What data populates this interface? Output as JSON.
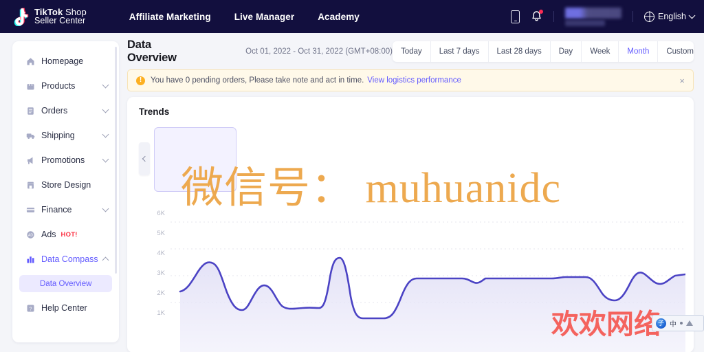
{
  "topnav": {
    "brand": {
      "line1_bold": "TikTok",
      "line1_thin": " Shop",
      "line2": "Seller Center"
    },
    "links": [
      {
        "label": "Affiliate Marketing"
      },
      {
        "label": "Live Manager"
      },
      {
        "label": "Academy"
      }
    ],
    "icons": {
      "mobile": "mobile-icon",
      "bell": "bell-icon"
    },
    "language": {
      "label": "English",
      "icon": "globe-icon"
    },
    "background": "#120f3e"
  },
  "sidebar": {
    "items": [
      {
        "label": "Homepage",
        "icon": "home-icon",
        "caret": false,
        "active": false
      },
      {
        "label": "Products",
        "icon": "bag-icon",
        "caret": "down",
        "active": false
      },
      {
        "label": "Orders",
        "icon": "list-icon",
        "caret": "down",
        "active": false
      },
      {
        "label": "Shipping",
        "icon": "truck-icon",
        "caret": "down",
        "active": false
      },
      {
        "label": "Promotions",
        "icon": "megaphone-icon",
        "caret": "down",
        "active": false
      },
      {
        "label": "Store Design",
        "icon": "store-icon",
        "caret": false,
        "active": false
      },
      {
        "label": "Finance",
        "icon": "card-icon",
        "caret": "down",
        "active": false
      },
      {
        "label": "Ads",
        "icon": "ads-icon",
        "caret": false,
        "active": false,
        "badge": "HOT!"
      },
      {
        "label": "Data Compass",
        "icon": "bar-chart-icon",
        "caret": "up",
        "active": true
      }
    ],
    "subitem": {
      "label": "Data Overview",
      "selected": true
    },
    "last_item": {
      "label": "Help Center",
      "icon": "help-icon"
    },
    "accent": "#635bff"
  },
  "main": {
    "page_title": "Data Overview",
    "date_range": "Oct 01, 2022 - Oct 31, 2022 (GMT+08:00)",
    "range_tabs": [
      {
        "label": "Today",
        "active": false
      },
      {
        "label": "Last 7 days",
        "active": false
      },
      {
        "label": "Last 28 days",
        "active": false
      },
      {
        "label": "Day",
        "active": false
      },
      {
        "label": "Week",
        "active": false
      },
      {
        "label": "Month",
        "active": true
      },
      {
        "label": "Custom",
        "active": false
      }
    ],
    "alert": {
      "icon": "warning-icon",
      "text": "You have 0 pending orders, Please take note and act in time.",
      "link": "View logistics performance",
      "close": "×",
      "bg": "#fff9e9",
      "border": "#f7e3b6"
    },
    "panel": {
      "title": "Trends",
      "scroll_left_icon": "chevron-left-icon"
    }
  },
  "chart_data": {
    "type": "area",
    "title": "Trends",
    "xlabel": "",
    "ylabel": "",
    "ylim": [
      0,
      6500
    ],
    "grid": true,
    "legend": null,
    "line_color": "#4b43c4",
    "fill_color": "#e7e6f7",
    "ytick_labels": [
      "1K",
      "2K",
      "3K",
      "4K",
      "5K",
      "6K"
    ],
    "ytick_values": [
      1000,
      2000,
      3000,
      4000,
      5000,
      6000
    ],
    "series": [
      {
        "name": "Trend",
        "values": [
          1850,
          2400,
          2950,
          2250,
          1500,
          1200,
          1350,
          2300,
          1900,
          1500,
          1450,
          1480,
          1500,
          3400,
          3300,
          1050,
          1030,
          1500,
          2950,
          3050,
          3050,
          2950,
          3050,
          3050,
          3050,
          3050,
          3050,
          2400,
          1800,
          2950,
          3100
        ]
      }
    ]
  },
  "watermarks": {
    "orange": "微信号： muhuanidc",
    "red": "欢欢网络",
    "orange_color": "#eda94f",
    "red_color": "#f4635e"
  },
  "ime": {
    "logo": "ime-logo-icon",
    "mode": "中",
    "punct": "ime-punct-icon",
    "shape": "ime-shape-icon"
  }
}
